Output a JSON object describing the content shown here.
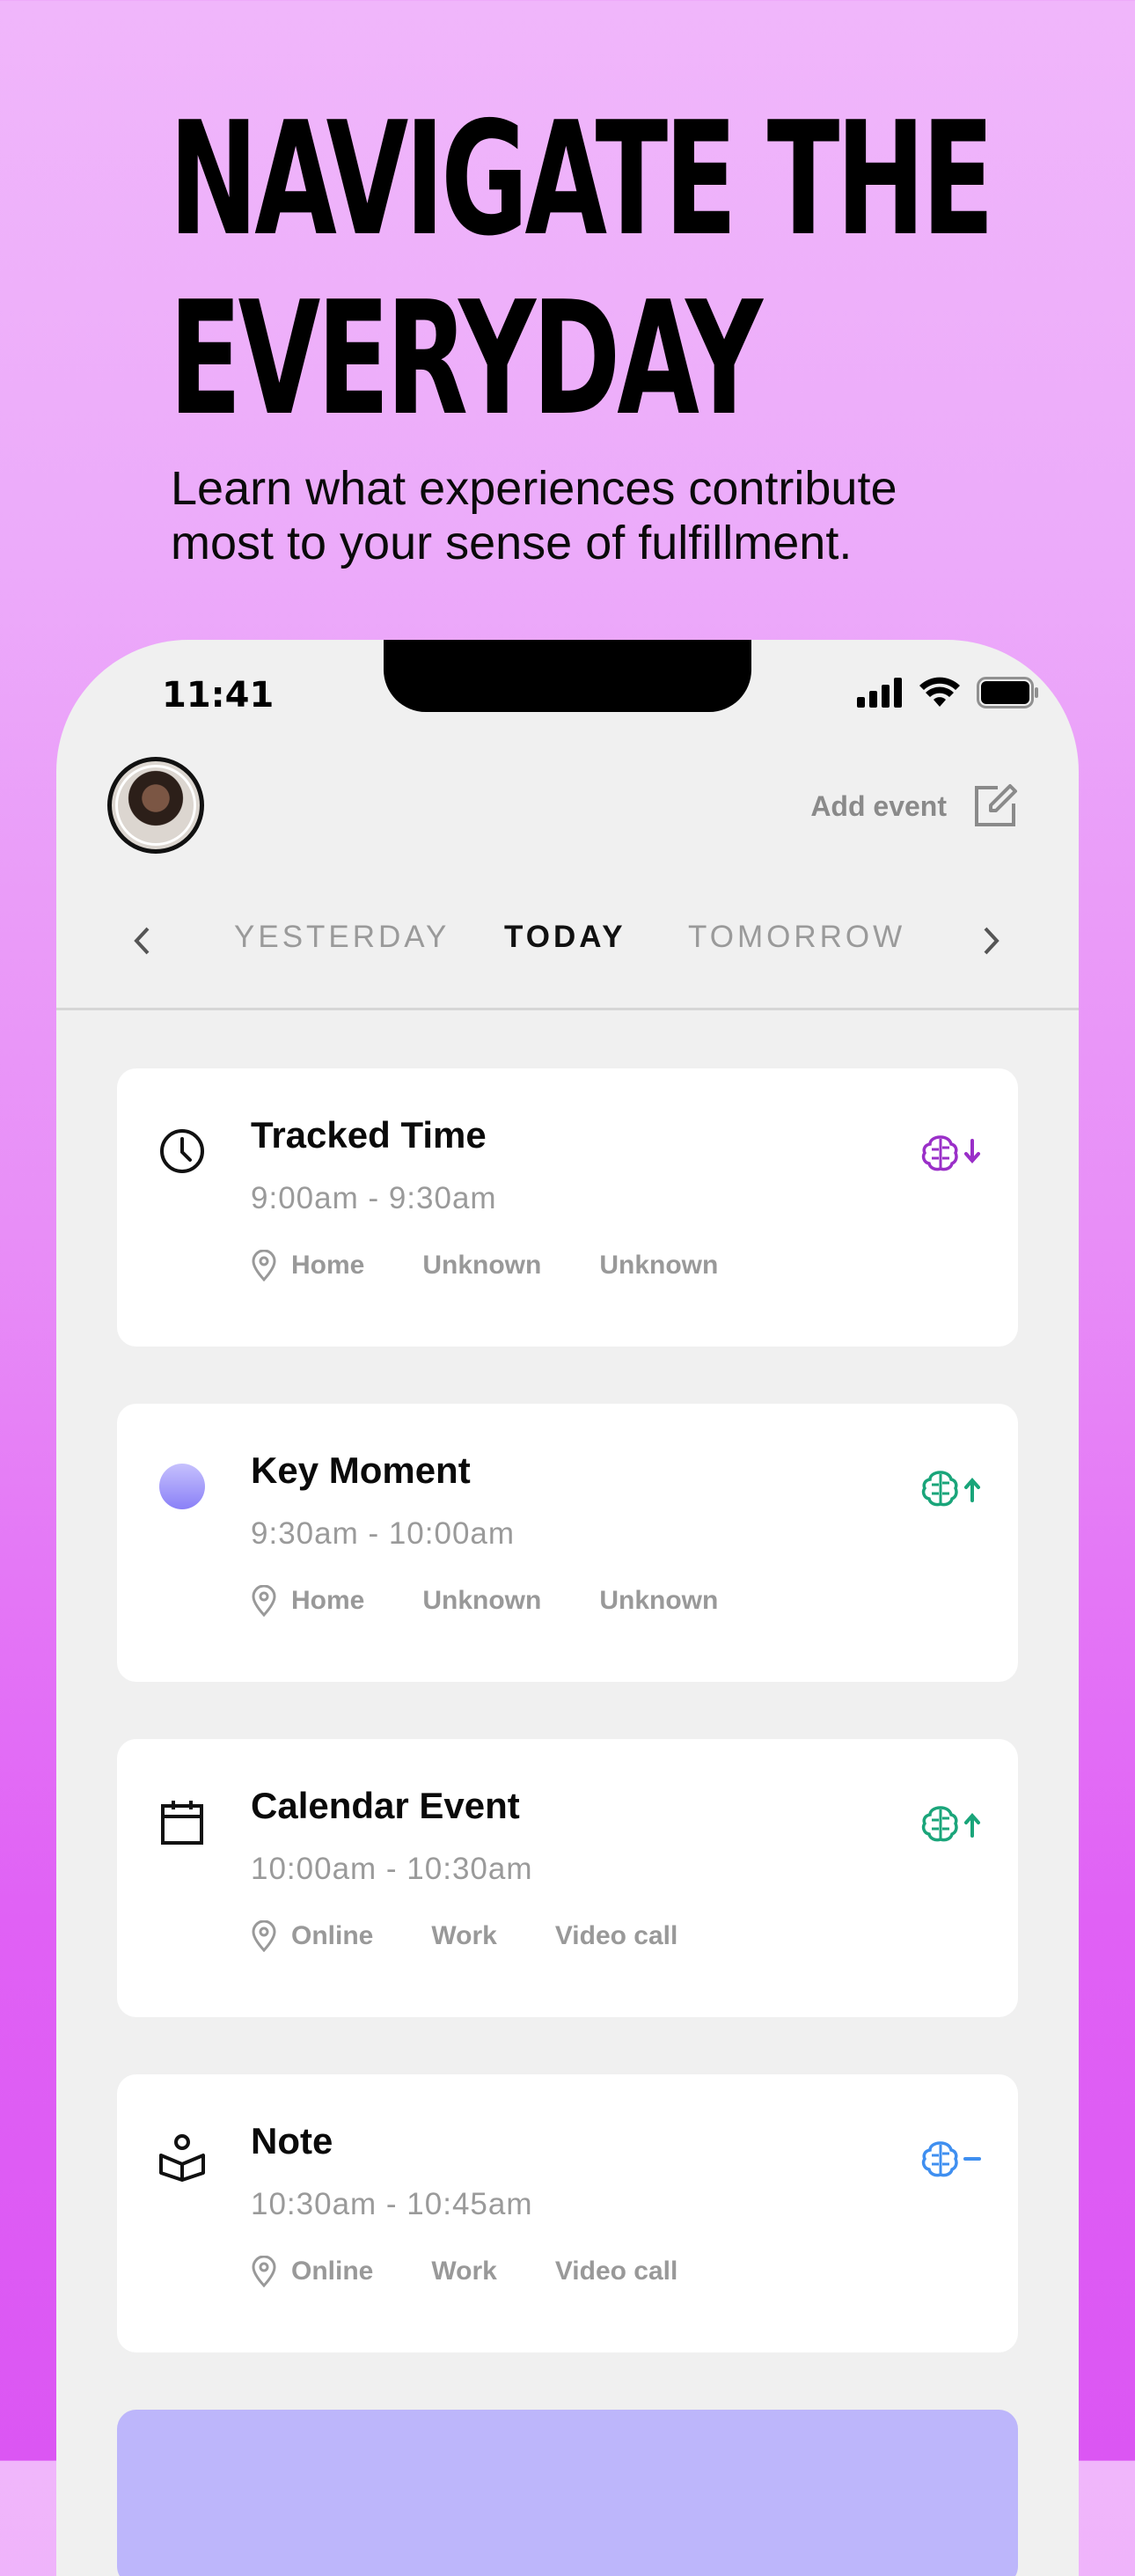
{
  "headline": [
    "NAVIGATE THE",
    "EVERYDAY"
  ],
  "subtitle": [
    "Learn what experiences contribute",
    "most to your sense of fulfillment."
  ],
  "status_bar": {
    "time": "11:41"
  },
  "header": {
    "add_event_label": "Add event"
  },
  "day_nav": {
    "previous": "YESTERDAY",
    "current": "TODAY",
    "next": "TOMORROW"
  },
  "colors": {
    "brain_purple": "#9a2fc8",
    "brain_green": "#1aa57a",
    "brain_blue": "#3f8ff0",
    "moment_dot": "#9c94fb"
  },
  "events": [
    {
      "icon": "clock-icon",
      "title": "Tracked Time",
      "time": "9:00am - 9:30am",
      "tags": [
        "Home",
        "Unknown",
        "Unknown"
      ],
      "mood": "down",
      "mood_icon": "brain-down-icon"
    },
    {
      "icon": "dot-icon",
      "title": "Key Moment",
      "time": "9:30am - 10:00am",
      "tags": [
        "Home",
        "Unknown",
        "Unknown"
      ],
      "mood": "up",
      "mood_icon": "brain-up-icon"
    },
    {
      "icon": "calendar-icon",
      "title": "Calendar Event",
      "time": "10:00am - 10:30am",
      "tags": [
        "Online",
        "Work",
        "Video call"
      ],
      "mood": "up",
      "mood_icon": "brain-up-icon"
    },
    {
      "icon": "note-icon",
      "title": "Note",
      "time": "10:30am - 10:45am",
      "tags": [
        "Online",
        "Work",
        "Video call"
      ],
      "mood": "neutral",
      "mood_icon": "brain-neutral-icon"
    }
  ]
}
